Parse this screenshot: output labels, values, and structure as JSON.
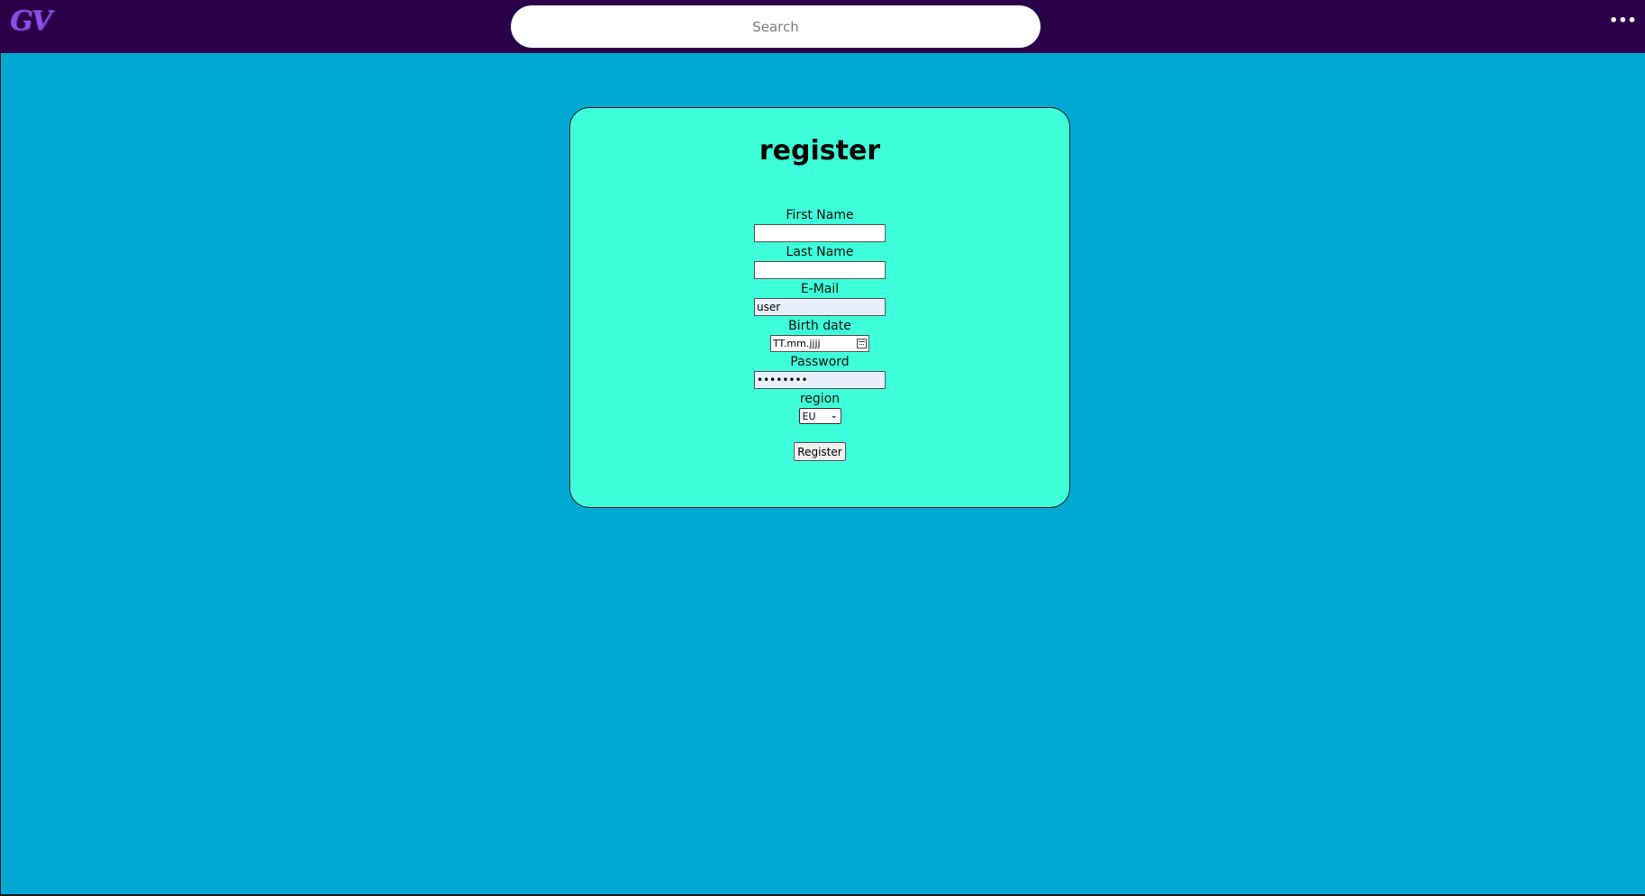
{
  "header": {
    "logo_text": "GV",
    "search_placeholder": "Search",
    "menu_label": "•••"
  },
  "register_card": {
    "title": "register",
    "fields": {
      "first_name_label": "First Name",
      "first_name_value": "",
      "last_name_label": "Last Name",
      "last_name_value": "",
      "email_label": "E-Mail",
      "email_value": "user",
      "birth_date_label": "Birth date",
      "birth_date_placeholder": "TT.mm.jjjj",
      "password_label": "Password",
      "password_value": "••••••••",
      "region_label": "region",
      "region_selected": "EU"
    },
    "submit_label": "Register"
  },
  "colors": {
    "topbar": "#2a0049",
    "page_background": "#00a8d4",
    "card_background": "#3dffd9",
    "logo": "#8a4fe0"
  }
}
